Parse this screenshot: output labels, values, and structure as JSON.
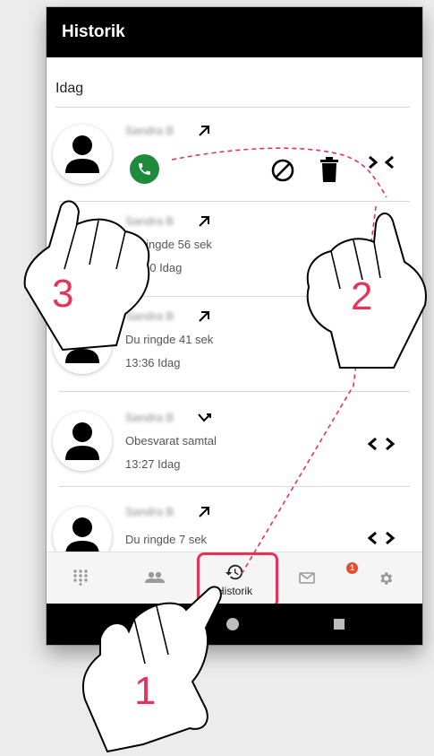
{
  "app": {
    "title": "Historik"
  },
  "section": {
    "label": "Idag"
  },
  "calls": [
    {
      "name": "Sandra B",
      "direction": "outgoing",
      "detail1": "",
      "detail2": "",
      "expanded": true
    },
    {
      "name": "Sandra B",
      "direction": "outgoing",
      "detail1": "Du ringde 56 sek",
      "detail2": "13:40 Idag"
    },
    {
      "name": "Sandra B",
      "direction": "outgoing",
      "detail1": "Du ringde 41 sek",
      "detail2": "13:36 Idag"
    },
    {
      "name": "Sandra B",
      "direction": "missed",
      "detail1": "Obesvarat samtal",
      "detail2": "13:27 Idag"
    },
    {
      "name": "Sandra B",
      "direction": "outgoing",
      "detail1": "Du ringde 7 sek",
      "detail2": ""
    }
  ],
  "visible_detail_overrides": {
    "row1_line2": "40 Idag",
    "row1_line1": "u ringde 56 sek"
  },
  "bottom_nav": {
    "items": [
      {
        "id": "dialpad",
        "icon": "dialpad-icon"
      },
      {
        "id": "contacts",
        "icon": "contacts-icon"
      },
      {
        "id": "history",
        "icon": "history-icon",
        "label": "Historik",
        "active": true
      },
      {
        "id": "messages",
        "icon": "mail-icon",
        "badge": "1"
      },
      {
        "id": "settings",
        "icon": "gear-icon"
      }
    ]
  },
  "annotations": {
    "step1": "1",
    "step2": "2",
    "step3": "3"
  },
  "colors": {
    "appbar": "#000000",
    "call_green": "#1f8a3b",
    "highlight": "#e5345a",
    "badge": "#e94c2a"
  }
}
